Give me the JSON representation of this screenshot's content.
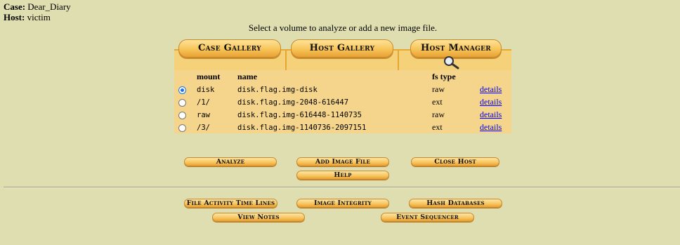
{
  "case": {
    "case_label": "Case:",
    "case_value": "Dear_Diary",
    "host_label": "Host:",
    "host_value": "victim"
  },
  "prompt": "Select a volume to analyze or add a new image file.",
  "tabs": {
    "case_gallery": "Case Gallery",
    "host_gallery": "Host Gallery",
    "host_manager": "Host Manager"
  },
  "table": {
    "headers": {
      "mount": "mount",
      "name": "name",
      "fs_type": "fs type"
    },
    "rows": [
      {
        "selected": true,
        "mount": "disk",
        "name": "disk.flag.img-disk",
        "fs_type": "raw",
        "link": "details"
      },
      {
        "selected": false,
        "mount": "/1/",
        "name": "disk.flag.img-2048-616447",
        "fs_type": "ext",
        "link": "details"
      },
      {
        "selected": false,
        "mount": "raw",
        "name": "disk.flag.img-616448-1140735",
        "fs_type": "raw",
        "link": "details"
      },
      {
        "selected": false,
        "mount": "/3/",
        "name": "disk.flag.img-1140736-2097151",
        "fs_type": "ext",
        "link": "details"
      }
    ]
  },
  "actions": {
    "analyze": "Analyze",
    "add_image": "Add Image File",
    "close_host": "Close Host",
    "help": "Help"
  },
  "tools": {
    "timelines": "File Activity Time Lines",
    "integrity": "Image Integrity",
    "hash_db": "Hash Databases",
    "notes": "View Notes",
    "sequencer": "Event Sequencer"
  },
  "colors": {
    "page_bg": "#dedeb0",
    "panel_bg": "#f5d58c",
    "button_orange": "#f7c458",
    "link_blue": "#0000ee"
  }
}
